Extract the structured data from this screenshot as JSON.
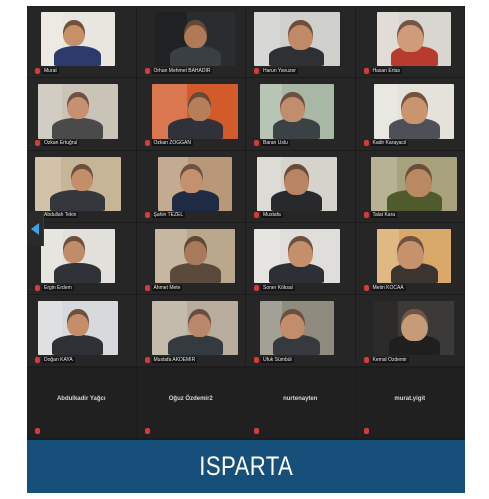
{
  "meeting": {
    "participants": [
      {
        "name": "Murat",
        "tone": "warm",
        "bg": "#e9e6df",
        "skin": "#c89068",
        "shirt": "#2c3b6b"
      },
      {
        "name": "Orhan Mehmet BAHADIR",
        "tone": "dark",
        "bg": "#2a2d30",
        "skin": "#b07a58",
        "shirt": "#3a3f44"
      },
      {
        "name": "Harun Yavuzer",
        "tone": "light",
        "bg": "#cfd0cc",
        "skin": "#c08a66",
        "shirt": "#2f3034"
      },
      {
        "name": "Hasan Ertas",
        "tone": "light",
        "bg": "#d9d6d1",
        "skin": "#cf9b78",
        "shirt": "#b73b2f"
      },
      {
        "name": "Özkan Ertuğrul",
        "tone": "warm",
        "bg": "#c9c3b8",
        "skin": "#c79070",
        "shirt": "#4a4a4a"
      },
      {
        "name": "Özkan ZOĞĞAN",
        "tone": "warm",
        "bg": "#d35a2a",
        "skin": "#b57f5a",
        "shirt": "#2f3238"
      },
      {
        "name": "Baran Uslu",
        "tone": "light",
        "bg": "#a9b7a6",
        "skin": "#c08e6c",
        "shirt": "#3c4145"
      },
      {
        "name": "Kadir Karayacıl",
        "tone": "light",
        "bg": "#e5e2dc",
        "skin": "#c9946e",
        "shirt": "#4d5157"
      },
      {
        "name": "Abdullah Tekin",
        "tone": "warm",
        "bg": "#c7b597",
        "skin": "#c48e6a",
        "shirt": "#34383c"
      },
      {
        "name": "Şahin TEZEL",
        "tone": "warm",
        "bg": "#b89878",
        "skin": "#c3916f",
        "shirt": "#1f2b45"
      },
      {
        "name": "Mustafa",
        "tone": "light",
        "bg": "#d6d3cd",
        "skin": "#b88463",
        "shirt": "#27292d"
      },
      {
        "name": "Talat Kara",
        "tone": "warm",
        "bg": "#a8a27c",
        "skin": "#b98962",
        "shirt": "#4f5a2d"
      },
      {
        "name": "Ergin Erdem",
        "tone": "light",
        "bg": "#e2e0da",
        "skin": "#c08d6a",
        "shirt": "#2f3337"
      },
      {
        "name": "Ahmet Mete",
        "tone": "warm",
        "bg": "#b9a88c",
        "skin": "#a67a5a",
        "shirt": "#5a4a3c"
      },
      {
        "name": "Soner Köksal",
        "tone": "light",
        "bg": "#e0dedb",
        "skin": "#c48f6b",
        "shirt": "#2c2f33"
      },
      {
        "name": "Metin KOCAA",
        "tone": "warm",
        "bg": "#d8a96a",
        "skin": "#c6926e",
        "shirt": "#3a3530"
      },
      {
        "name": "Doğan KAYA",
        "tone": "light",
        "bg": "#d8d9dc",
        "skin": "#c48e6b",
        "shirt": "#2d3136"
      },
      {
        "name": "Mustafa AKDEMIR",
        "tone": "warm",
        "bg": "#b8ad9c",
        "skin": "#b9876a",
        "shirt": "#353a40"
      },
      {
        "name": "Ufuk Sümbül",
        "tone": "warm",
        "bg": "#8f8b7e",
        "skin": "#c18d6b",
        "shirt": "#363a3e"
      },
      {
        "name": "Kemal Özdemir",
        "tone": "dark",
        "bg": "#3b3a38",
        "skin": "#c79a78",
        "shirt": "#1f1f1f"
      }
    ],
    "audio_only": [
      {
        "name": "Abdulkadir Yağcı"
      },
      {
        "name": "Oğuz Özdemir2"
      },
      {
        "name": "nurtenayten"
      },
      {
        "name": "murat.yigit"
      }
    ]
  },
  "banner": {
    "text": "ISPARTA",
    "color": "#16507a"
  },
  "colors": {
    "background": "#1c1c1c",
    "tile": "#262626",
    "mic_muted": "#d63a3a"
  },
  "icons": {
    "prev": "chevron-left-icon",
    "mic": "muted-mic-icon"
  }
}
